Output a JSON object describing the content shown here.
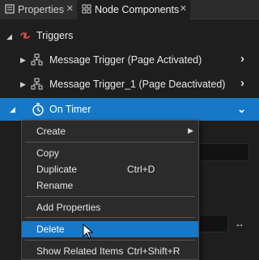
{
  "tabs": [
    {
      "label": "Properties",
      "close": "✕"
    },
    {
      "label": "Node Components",
      "close": "✕"
    }
  ],
  "tree": {
    "triggers_label": "Triggers",
    "items": [
      {
        "label": "Message Trigger (Page Activated)"
      },
      {
        "label": "Message Trigger_1 (Page Deactivated)"
      },
      {
        "label": "On Timer"
      }
    ]
  },
  "context_menu": {
    "create": "Create",
    "copy": "Copy",
    "duplicate": "Duplicate",
    "duplicate_shortcut": "Ctrl+D",
    "rename": "Rename",
    "add_properties": "Add Properties",
    "delete": "Delete",
    "show_related": "Show Related Items",
    "show_related_shortcut": "Ctrl+Shift+R"
  },
  "colors": {
    "selection": "#1778c8",
    "accent_red": "#e05050"
  }
}
